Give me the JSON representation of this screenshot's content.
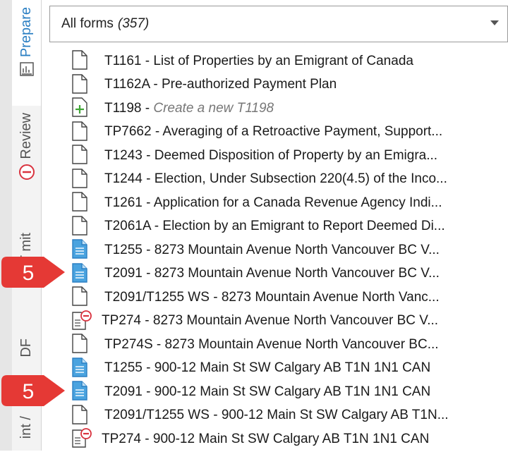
{
  "sidebar": {
    "tabs": [
      {
        "label": "Prepare",
        "icon": "form-chart-icon",
        "active": true
      },
      {
        "label": "Review",
        "icon": "minus-circle-icon",
        "active": false
      },
      {
        "label": "Transmit",
        "visible_text": "T mit",
        "icon": "check-circle-icon",
        "active": false
      },
      {
        "label": "PDF",
        "visible_text": "DF",
        "active": false
      },
      {
        "label": "Print / PDF",
        "visible_text": "int /",
        "active": false
      }
    ]
  },
  "dropdown": {
    "label": "All forms",
    "count": "(357)"
  },
  "forms": [
    {
      "code": "T1161",
      "desc": "List of Properties by an Emigrant of Canada",
      "icon": "blank-doc-icon"
    },
    {
      "code": "T1162A",
      "desc": "Pre-authorized Payment Plan",
      "icon": "blank-doc-icon"
    },
    {
      "code": "T1198",
      "desc": "Create a new T1198",
      "icon": "add-doc-icon",
      "italic": true
    },
    {
      "code": "TP7662",
      "desc": "Averaging of a Retroactive Payment, Support...",
      "icon": "blank-doc-icon"
    },
    {
      "code": "T1243",
      "desc": "Deemed Disposition of Property by an Emigra...",
      "icon": "blank-doc-icon"
    },
    {
      "code": "T1244",
      "desc": "Election, Under Subsection 220(4.5) of the Inco...",
      "icon": "blank-doc-icon"
    },
    {
      "code": "T1261",
      "desc": "Application for a Canada Revenue Agency Indi...",
      "icon": "blank-doc-icon"
    },
    {
      "code": "T2061A",
      "desc": "Election by an Emigrant to Report Deemed Di...",
      "icon": "blank-doc-icon"
    },
    {
      "code": "T1255",
      "desc": "8273 Mountain Avenue North Vancouver BC V...",
      "icon": "filled-doc-icon"
    },
    {
      "code": "T2091",
      "desc": "8273 Mountain Avenue North Vancouver BC V...",
      "icon": "filled-doc-icon"
    },
    {
      "code": "T2091/T1255 WS",
      "desc": "8273 Mountain Avenue North Vanc...",
      "icon": "blank-doc-icon"
    },
    {
      "code": "TP274",
      "desc": "8273 Mountain Avenue North Vancouver BC V...",
      "icon": "error-doc-icon"
    },
    {
      "code": "TP274S",
      "desc": "8273 Mountain Avenue North Vancouver BC...",
      "icon": "blank-doc-icon"
    },
    {
      "code": "T1255",
      "desc": "900-12 Main St SW Calgary AB T1N 1N1 CAN",
      "icon": "filled-doc-icon"
    },
    {
      "code": "T2091",
      "desc": "900-12 Main St SW Calgary AB T1N 1N1 CAN",
      "icon": "filled-doc-icon"
    },
    {
      "code": "T2091/T1255 WS",
      "desc": "900-12 Main St SW Calgary AB T1N...",
      "icon": "blank-doc-icon"
    },
    {
      "code": "TP274",
      "desc": "900-12 Main St SW Calgary AB T1N 1N1 CAN",
      "icon": "error-doc-icon"
    }
  ],
  "callouts": [
    {
      "number": "5",
      "points_to": "T2091 - 8273 Mountain Avenue"
    },
    {
      "number": "5",
      "points_to": "T2091 - 900-12 Main St SW"
    }
  ],
  "colors": {
    "accent": "#2b7fc3",
    "callout": "#e53935",
    "filled_doc": "#4aa3df",
    "add_green": "#3fa535",
    "error_red": "#d9333f"
  }
}
